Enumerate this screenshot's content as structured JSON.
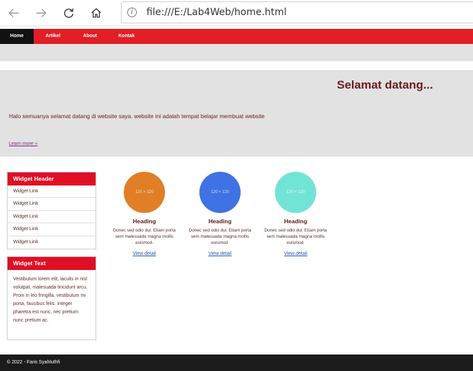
{
  "browser": {
    "url": "file:///E:/Lab4Web/home.html",
    "info_glyph": "i"
  },
  "nav": {
    "items": [
      {
        "label": "Home"
      },
      {
        "label": "Artikel"
      },
      {
        "label": "About"
      },
      {
        "label": "Kontak"
      }
    ]
  },
  "hero": {
    "title": "Selamat datang...",
    "text": "Halo semuanya selamat datang di website saya. website ini adalah tempat belajar membuat website",
    "link": "Learn more »"
  },
  "widget_links": {
    "header": "Widget Header",
    "links": [
      "Widget Link",
      "Widget Link",
      "Widget Link",
      "Widget Link",
      "Widget Link"
    ]
  },
  "widget_text": {
    "header": "Widget Text",
    "body": "Vestibulum lorem elit, iaculis in nisl volutpat, malesuada tincidunt arcu. Proin in leo fringilla, vestibulum mi porta, faucibus felis. Integer pharetra est nunc, nec pretium nunc pretium ac."
  },
  "cards": [
    {
      "thumb": "120 × 120",
      "color": "#e07f25",
      "heading": "Heading",
      "text": "Donec sed odio dui. Etiam porta sem malesuada magna mollis euismod.",
      "link": "View detail"
    },
    {
      "thumb": "120 × 120",
      "color": "#3f72e2",
      "heading": "Heading",
      "text": "Donec sed odio dui. Etiam porta sem malesuada magna mollis euismod.",
      "link": "View detail"
    },
    {
      "thumb": "120 × 120",
      "color": "#72e4d6",
      "heading": "Heading",
      "text": "Donec sed odio dui. Etiam porta sem malesuada magna mollis euismod.",
      "link": "View detail"
    }
  ],
  "footer": {
    "text": "© 2022 - Faris Syahluthfi"
  },
  "colors": {
    "brand": "#e21e26",
    "nav_active": "#111111",
    "footer": "#1b1b1b"
  }
}
